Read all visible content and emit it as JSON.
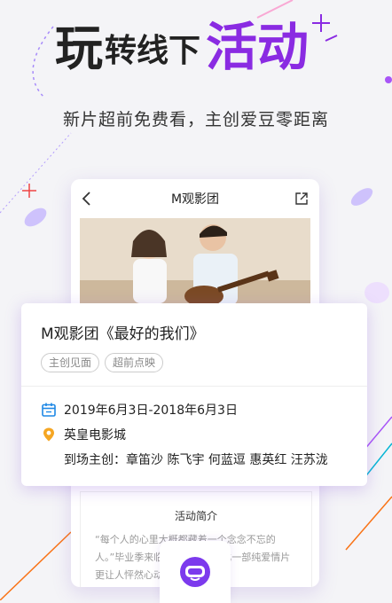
{
  "hero": {
    "title_part1": "玩",
    "title_part2": "转线下",
    "title_part3": "活动",
    "subtitle": "新片超前免费看，主创爱豆零距离"
  },
  "phone": {
    "header_title": "M观影团",
    "detail": {
      "title": "活动简介",
      "text": "“每个人的心里大概都藏着一个念念不忘的人。”毕业季来临，还有什么能比一部纯爱情片更让人怦然心动的呢"
    }
  },
  "card": {
    "title": "M观影团《最好的我们》",
    "tags": [
      "主创见面",
      "超前点映"
    ],
    "date": "2019年6月3日-2018年6月3日",
    "location": "英皇电影城",
    "guests_label": "到场主创：",
    "guests": "章笛沙 陈飞宇 何蓝逗 惠英红 汪苏泷"
  },
  "colors": {
    "accent": "#8a2be2",
    "icon_blue": "#1e88e5",
    "icon_orange": "#f5a623"
  }
}
